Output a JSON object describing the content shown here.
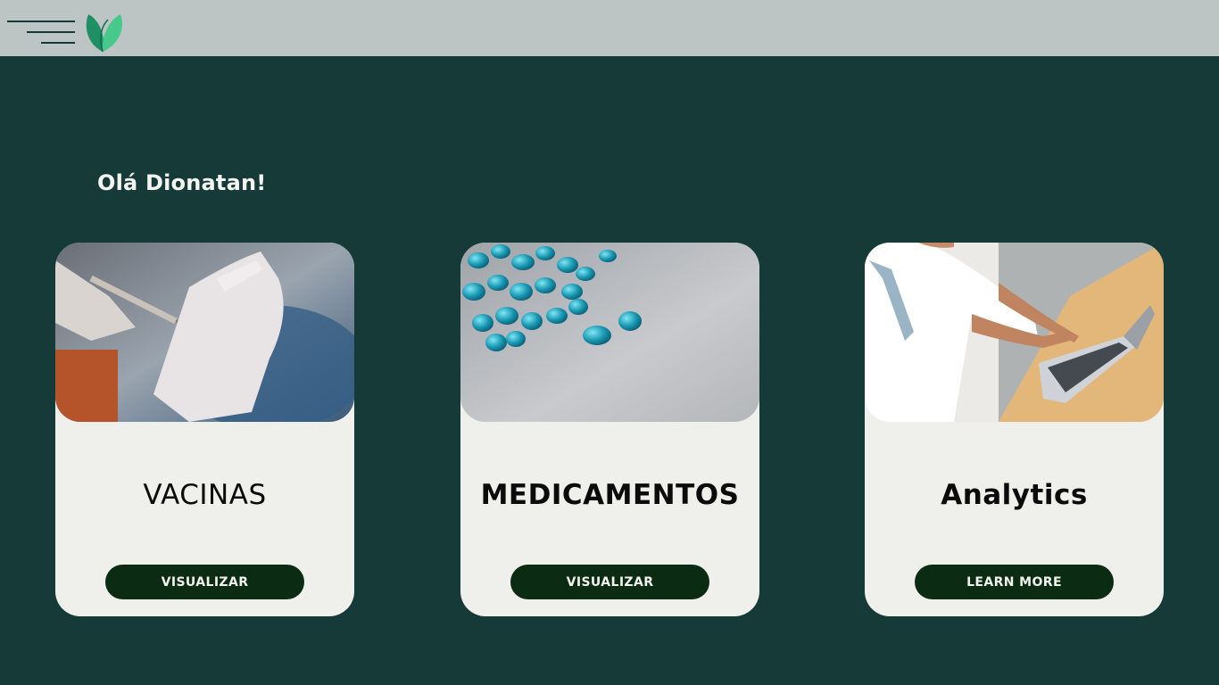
{
  "header": {
    "menu_icon": "hamburger-icon",
    "logo_icon": "leaf-logo-icon",
    "logo_colors": [
      "#1f9c6a",
      "#4fd08c"
    ]
  },
  "greeting": "Olá Dionatan!",
  "cards": [
    {
      "title": "VACINAS",
      "button": "VISUALIZAR",
      "image": "vaccine-syringe-image"
    },
    {
      "title": "MEDICAMENTOS",
      "button": "VISUALIZAR",
      "image": "blue-capsules-image"
    },
    {
      "title": "Analytics",
      "button": "LEARN MORE",
      "image": "person-laptop-image"
    }
  ],
  "colors": {
    "background": "#163a38",
    "topbar": "#bcc5c4",
    "card": "#efefeb",
    "button": "#0c2b13"
  }
}
